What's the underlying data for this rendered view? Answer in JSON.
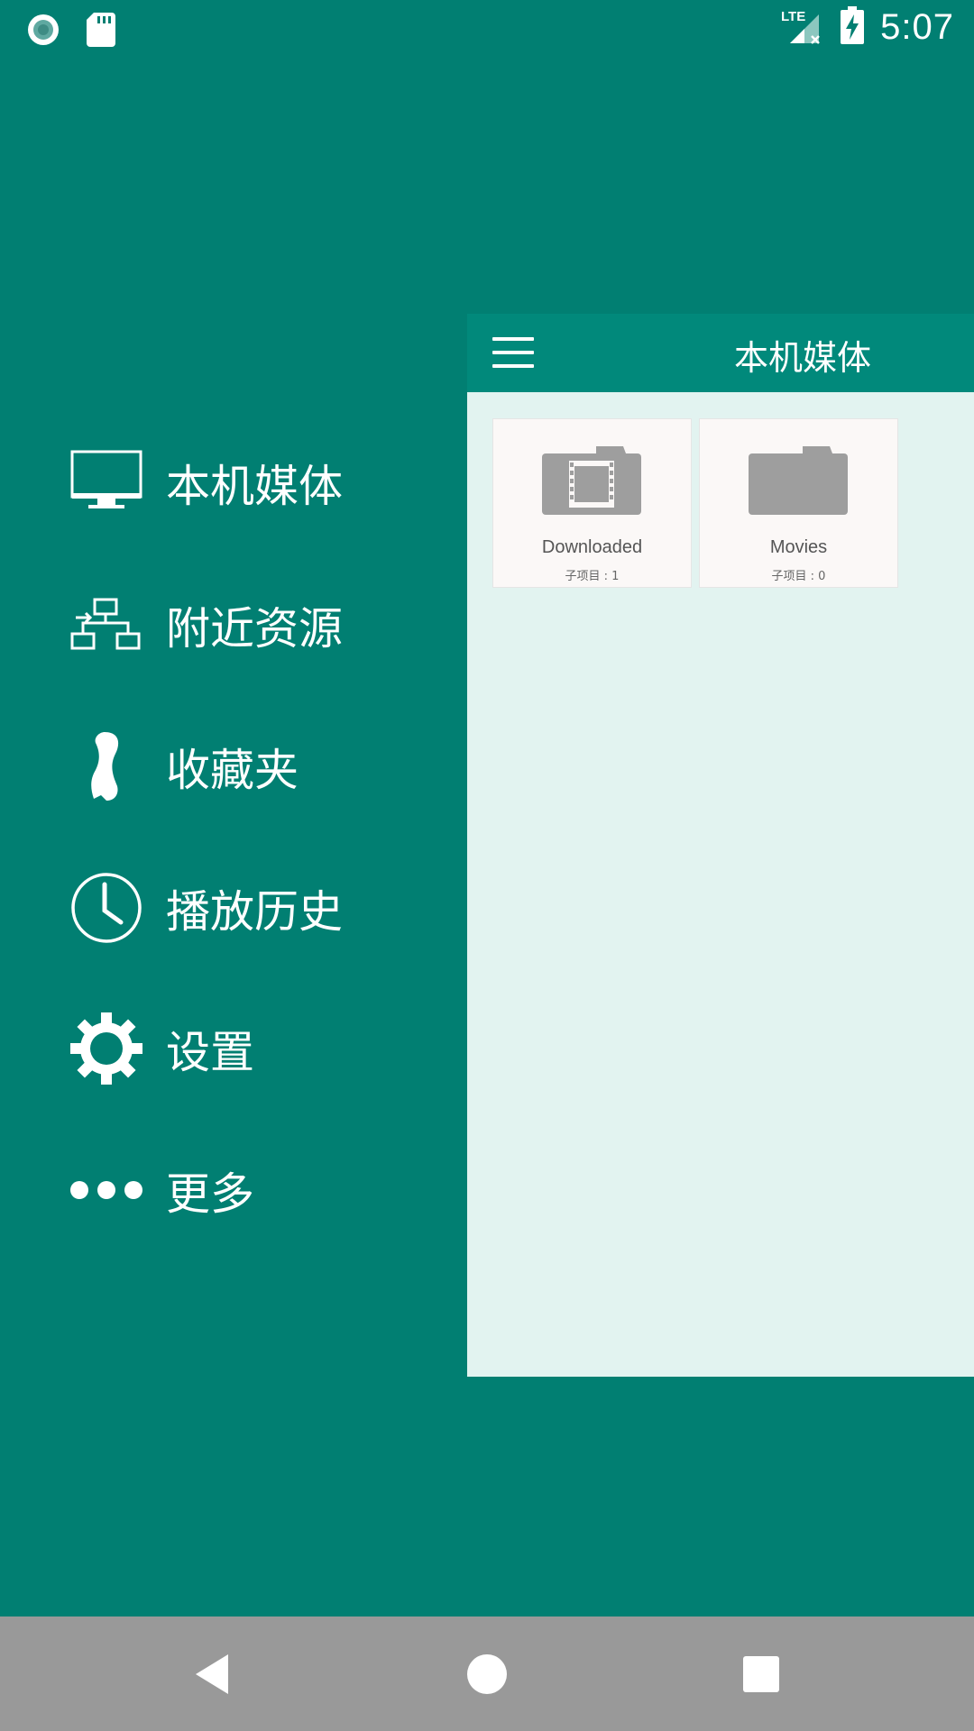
{
  "status_bar": {
    "time": "5:07",
    "icons": [
      "record-icon",
      "sd-card-icon",
      "lte-signal-icon",
      "battery-charging-icon"
    ],
    "network_label": "LTE"
  },
  "drawer": {
    "items": [
      {
        "label": "本机媒体",
        "icon": "monitor-icon"
      },
      {
        "label": "附近资源",
        "icon": "network-icon"
      },
      {
        "label": "收藏夹",
        "icon": "ribbon-icon"
      },
      {
        "label": "播放历史",
        "icon": "clock-icon"
      },
      {
        "label": "设置",
        "icon": "gear-icon"
      },
      {
        "label": "更多",
        "icon": "more-dots-icon"
      }
    ]
  },
  "app_bar": {
    "title": "本机媒体",
    "menu_icon": "hamburger-icon"
  },
  "folders": [
    {
      "name": "Downloaded",
      "count": "子项目 : 1",
      "icon": "video-folder-icon"
    },
    {
      "name": "Movies",
      "count": "子项目 : 0",
      "icon": "folder-icon"
    }
  ],
  "nav_bar": {
    "buttons": [
      "back-icon",
      "home-icon",
      "recents-icon"
    ]
  },
  "colors": {
    "primary": "#017F72",
    "app_bar": "#01897B",
    "panel_bg": "#E2F3F0",
    "nav_bar": "#999999"
  }
}
